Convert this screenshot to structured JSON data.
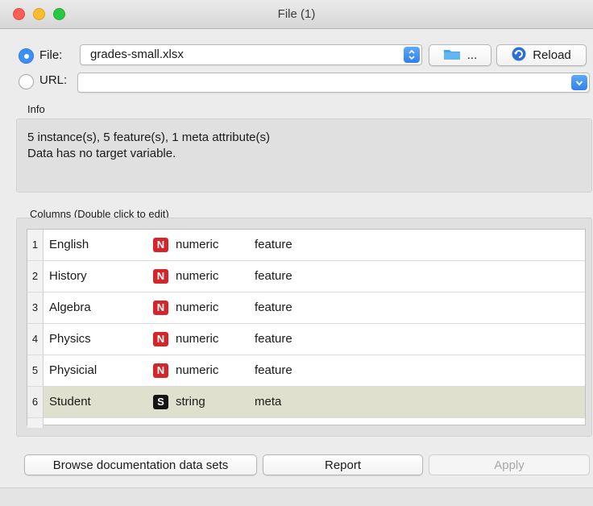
{
  "window": {
    "title": "File (1)"
  },
  "source": {
    "file_label": "File:",
    "url_label": "URL:",
    "file_value": "grades-small.xlsx",
    "url_value": "",
    "browse_label": "...",
    "reload_label": "Reload",
    "selected": "file"
  },
  "info": {
    "heading": "Info",
    "line1": "5 instance(s), 5 feature(s), 1 meta attribute(s)",
    "line2": "Data has no target variable."
  },
  "columns": {
    "heading": "Columns (Double click to edit)",
    "rows": [
      {
        "index": "1",
        "name": "English",
        "type_letter": "N",
        "type": "numeric",
        "role": "feature"
      },
      {
        "index": "2",
        "name": "History",
        "type_letter": "N",
        "type": "numeric",
        "role": "feature"
      },
      {
        "index": "3",
        "name": "Algebra",
        "type_letter": "N",
        "type": "numeric",
        "role": "feature"
      },
      {
        "index": "4",
        "name": "Physics",
        "type_letter": "N",
        "type": "numeric",
        "role": "feature"
      },
      {
        "index": "5",
        "name": "Physicial",
        "type_letter": "N",
        "type": "numeric",
        "role": "feature"
      },
      {
        "index": "6",
        "name": "Student",
        "type_letter": "S",
        "type": "string",
        "role": "meta"
      }
    ]
  },
  "buttons": {
    "browse_docs": "Browse documentation data sets",
    "report": "Report",
    "apply": "Apply"
  },
  "colors": {
    "accent": "#3b8ff7",
    "numeric_badge": "#d4252b",
    "string_badge": "#141414",
    "meta_row": "#e0e0cf"
  }
}
